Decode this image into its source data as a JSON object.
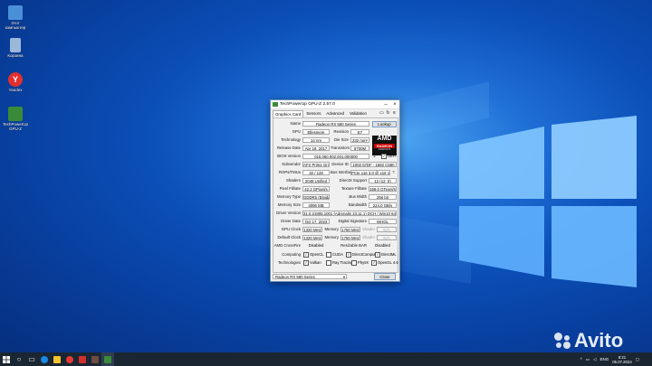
{
  "desktop": {
    "icons": [
      {
        "label": "Этот компьютер",
        "color": "#4a90d9"
      },
      {
        "label": "Корзина",
        "color": "#9bb8d8"
      },
      {
        "label": "Yandex",
        "color": "#e03030"
      },
      {
        "label": "TechPowerUp GPU-Z",
        "color": "#3a8a3a"
      }
    ]
  },
  "window": {
    "title": "TechPowerUp GPU-Z 2.57.0",
    "tabs": [
      "Graphics Card",
      "Sensors",
      "Advanced",
      "Validation"
    ],
    "tab_tools": [
      "camera-icon",
      "refresh-icon",
      "menu-icon"
    ],
    "lookup_label": "Lookup",
    "uefi_label": "UEFI",
    "vendor_logo": {
      "line1": "AMD",
      "line2": "RADEON",
      "line3": "GRAPHICS"
    },
    "rows": {
      "name": {
        "label": "Name",
        "value": "Radeon RX 580 Series"
      },
      "gpu": {
        "label": "GPU",
        "value": "Ellesmere",
        "label2": "Revision",
        "value2": "E7"
      },
      "technology": {
        "label": "Technology",
        "value": "14 nm",
        "label2": "Die Size",
        "value2": "232 mm²"
      },
      "release": {
        "label": "Release Date",
        "value": "Apr 18, 2017",
        "label2": "Transistors",
        "value2": "5700M"
      },
      "bios": {
        "label": "BIOS Version",
        "value": "015.050.002.001.000000"
      },
      "subvendor": {
        "label": "Subvendor",
        "value": "AFX Prime Group",
        "label2": "Device ID",
        "value2": "1002 67DF - 1682 C580"
      },
      "rops": {
        "label": "ROPs/TMUs",
        "value": "32 / 128",
        "label2": "Bus Interface",
        "value2": "PCIe x16 3.0 @ x16 1.1",
        "help": "?"
      },
      "shaders": {
        "label": "Shaders",
        "value": "2048 Unified",
        "label2": "DirectX Support",
        "value2": "12 (12_0)"
      },
      "pixel": {
        "label": "Pixel Fillrate",
        "value": "42.2 GPixel/s",
        "label2": "Texture Fillrate",
        "value2": "169.0 GTexel/s"
      },
      "memtype": {
        "label": "Memory Type",
        "value": "GDDR5 (Elpida)",
        "label2": "Bus Width",
        "value2": "256 bit"
      },
      "memsize": {
        "label": "Memory Size",
        "value": "4096 MB",
        "label2": "Bandwidth",
        "value2": "224.0 GB/s"
      },
      "driver": {
        "label": "Driver Version",
        "value": "31.0.21905.1001 (Adrenalin 23.11.1) DCH / Win10 64"
      },
      "driverdate": {
        "label": "Driver Date",
        "value": "Oct 17, 2023",
        "label2": "Digital Signature",
        "value2": "WHQL"
      },
      "gpuclock": {
        "label": "GPU Clock",
        "value": "1320 MHz",
        "label2": "Memory",
        "value2": "1750 MHz",
        "label3": "Shader",
        "value3": "N/A"
      },
      "defclock": {
        "label": "Default Clock",
        "value": "1320 MHz",
        "label2": "Memory",
        "value2": "1750 MHz",
        "label3": "Shader",
        "value3": "N/A"
      },
      "crossfire": {
        "label": "AMD CrossFire",
        "value": "Disabled",
        "label2": "Resizable BAR",
        "value2": "Disabled"
      }
    },
    "computing": {
      "label": "Computing",
      "items": [
        {
          "name": "OpenCL",
          "checked": true
        },
        {
          "name": "CUDA",
          "checked": false
        },
        {
          "name": "DirectCompute",
          "checked": true
        },
        {
          "name": "DirectML",
          "checked": true
        }
      ]
    },
    "technologies": {
      "label": "Technologies",
      "items": [
        {
          "name": "Vulkan",
          "checked": true
        },
        {
          "name": "Ray Tracing",
          "checked": false
        },
        {
          "name": "PhysX",
          "checked": false
        },
        {
          "name": "OpenGL 4.6",
          "checked": true
        }
      ]
    },
    "selector_value": "Radeon RX 580 Series",
    "close_label": "Close"
  },
  "taskbar": {
    "icons": [
      "windows-start-icon",
      "search-icon",
      "task-view-icon",
      "edge-icon",
      "explorer-icon",
      "yandex-icon",
      "opera-icon",
      "game-icon",
      "gpuz-icon"
    ],
    "tray_lang": "ENG",
    "time": "8:21",
    "date": "05.07.2024"
  },
  "watermark": "Avito"
}
